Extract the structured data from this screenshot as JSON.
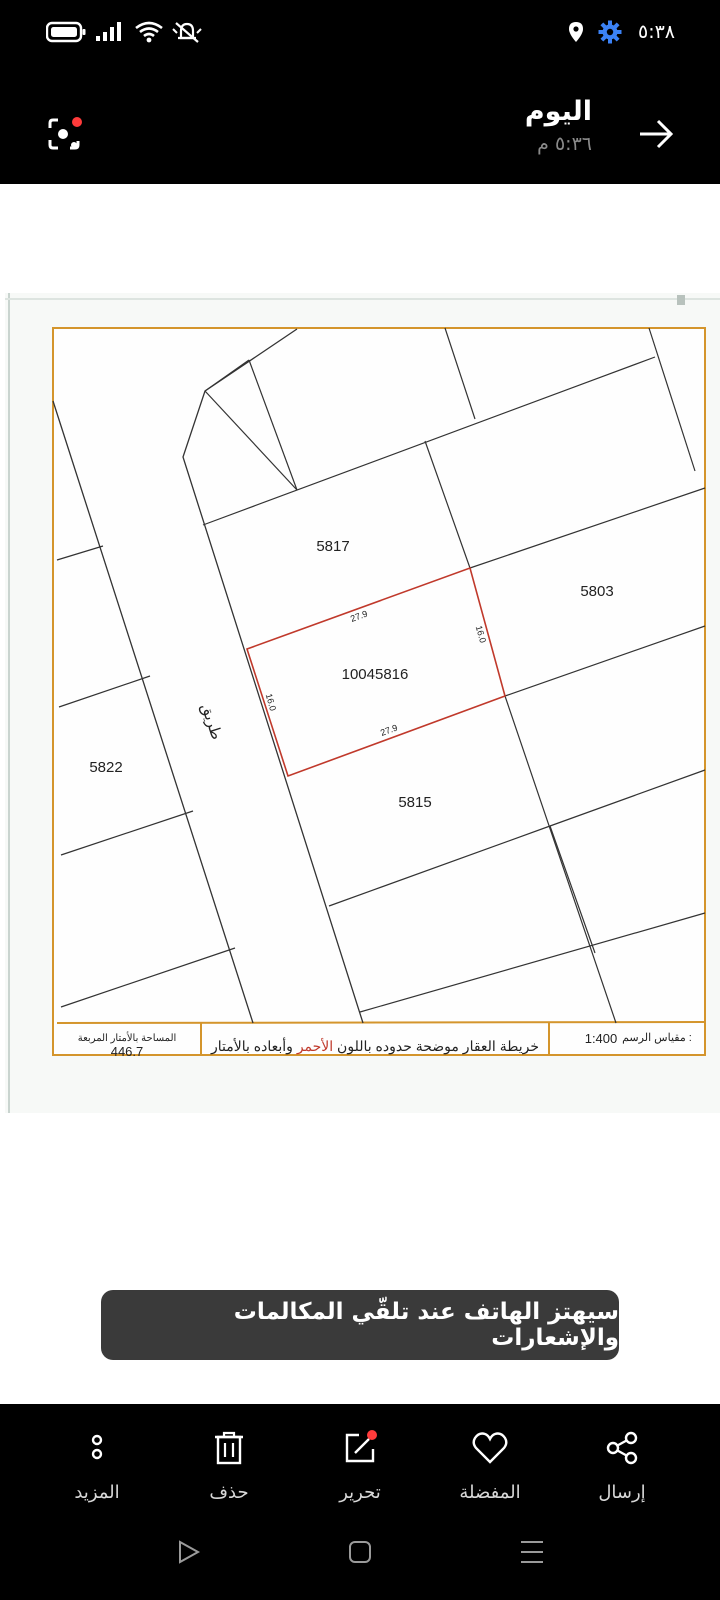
{
  "status_bar": {
    "time": "٥:٣٨",
    "icons": [
      "battery-icon",
      "signal-icon",
      "wifi-icon",
      "mute-icon",
      "location-icon",
      "settings-gear-icon"
    ]
  },
  "header": {
    "title": "اليوم",
    "subtitle": "٥:٣٦ م",
    "back_icon": "arrow-right-icon",
    "lens_icon": "scan-lens-icon"
  },
  "image": {
    "parcels": {
      "p5817": "5817",
      "p5803": "5803",
      "main": "10045816",
      "p5815": "5815",
      "p5822": "5822"
    },
    "dimensions": {
      "top": "27.9",
      "bottom": "27.9",
      "left": "16.0",
      "right": "16.0"
    },
    "road_label": "طريق",
    "footer": {
      "area_label": "المساحة بالأمتار المربعة",
      "area_value": "446.7",
      "caption_part1": "خريطة العقار موضحة حدوده باللون ",
      "caption_red": "الأحمر",
      "caption_part2": " وأبعاده بالأمتار",
      "scale_label": "مقياس الرسم :",
      "scale_value": "1:400"
    },
    "colors": {
      "border": "#d4952c",
      "lines": "#333333",
      "highlight": "#c0392b"
    }
  },
  "toast": {
    "text": "سيهتز الهاتف عند تلقّي المكالمات والإشعارات"
  },
  "actions": [
    {
      "label": "إرسال",
      "icon": "share-icon"
    },
    {
      "label": "المفضلة",
      "icon": "heart-icon"
    },
    {
      "label": "تحرير",
      "icon": "edit-icon"
    },
    {
      "label": "حذف",
      "icon": "trash-icon"
    },
    {
      "label": "المزيد",
      "icon": "more-icon"
    }
  ],
  "nav": [
    "back-nav-icon",
    "home-nav-icon",
    "recents-nav-icon"
  ]
}
